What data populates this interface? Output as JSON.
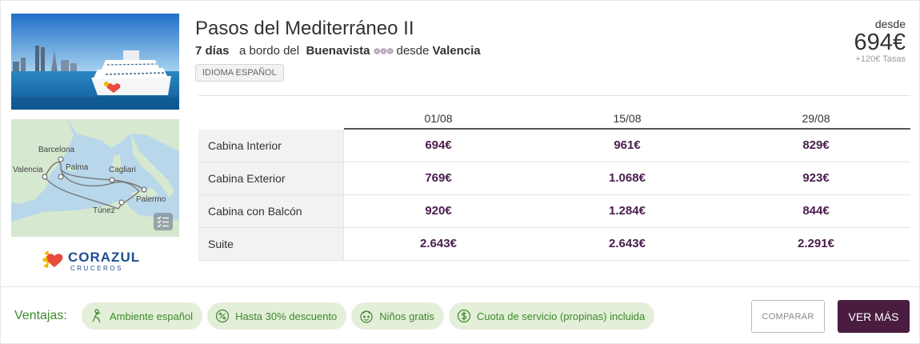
{
  "cruise": {
    "title": "Pasos del Mediterráneo II",
    "days": "7 días",
    "aboard_text": "a bordo del",
    "ship_name": "Buenavista",
    "ship_rating": "❁❁❁",
    "from_text": "desde",
    "departure_port": "Valencia",
    "language_badge": "IDIOMA ESPAÑOL"
  },
  "price": {
    "from_label": "desde",
    "amount": "694€",
    "taxes": "+120€ Tasas"
  },
  "map": {
    "cities": [
      "Barcelona",
      "Palma",
      "Valencia",
      "Cagliari",
      "Palermo",
      "Túnez"
    ]
  },
  "brand": {
    "name": "CORAZUL",
    "sub": "CRUCEROS"
  },
  "fares": {
    "dates": [
      "01/08",
      "15/08",
      "29/08"
    ],
    "rows": [
      {
        "cabin": "Cabina Interior",
        "prices": [
          "694€",
          "961€",
          "829€"
        ]
      },
      {
        "cabin": "Cabina Exterior",
        "prices": [
          "769€",
          "1.068€",
          "923€"
        ]
      },
      {
        "cabin": "Cabina con Balcón",
        "prices": [
          "920€",
          "1.284€",
          "844€"
        ]
      },
      {
        "cabin": "Suite",
        "prices": [
          "2.643€",
          "2.643€",
          "2.291€"
        ]
      }
    ]
  },
  "ventajas": {
    "label": "Ventajas:",
    "items": [
      {
        "label": "Ambiente español",
        "icon": "flamenco-icon"
      },
      {
        "label": "Hasta 30% descuento",
        "icon": "percent-icon"
      },
      {
        "label": "Niños gratis",
        "icon": "child-face-icon"
      },
      {
        "label": "Cuota de servicio (propinas) incluida",
        "icon": "dollar-coin-icon"
      }
    ]
  },
  "actions": {
    "compare_label": "COMPARAR",
    "more_label": "VER MÁS"
  },
  "colors": {
    "price_purple": "#4a1d4d",
    "button_purple": "#4a1d40",
    "chip_green_bg": "#e3efd8",
    "chip_green_text": "#3d8a2d",
    "brand_blue": "#1d4e8f"
  }
}
